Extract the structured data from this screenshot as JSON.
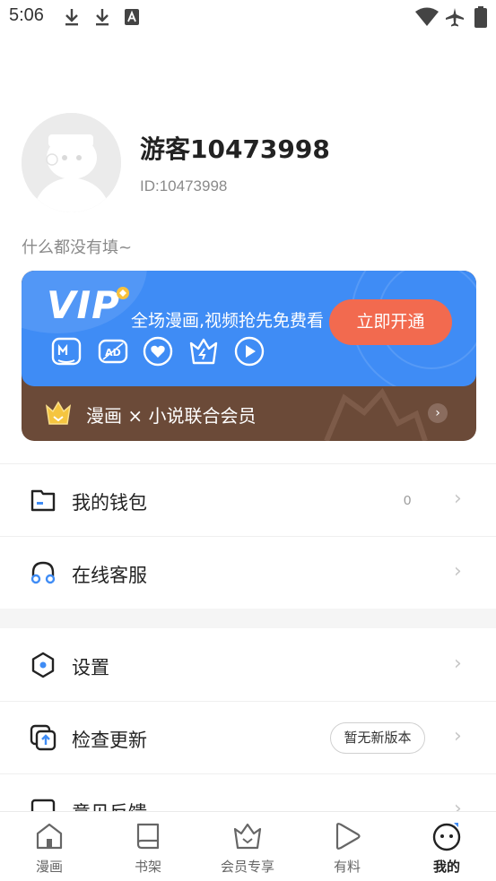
{
  "status_bar": {
    "time": "5:06",
    "icons": [
      "download-icon",
      "download-icon",
      "font-icon",
      "wifi-icon",
      "airplane-icon",
      "battery-icon"
    ]
  },
  "profile": {
    "username": "游客10473998",
    "user_id": "ID:10473998",
    "bio": "什么都没有填~"
  },
  "vip_card": {
    "logo": "VIP",
    "tagline": "全场漫画,视频抢先免费看",
    "open_button": "立即开通",
    "perk_icons": [
      "manga-icon",
      "no-ads-icon",
      "heart-icon",
      "crown-icon",
      "play-icon"
    ],
    "joint_membership": "漫画 × 小说联合会员",
    "colors": {
      "blue": "#3f8cf5",
      "brown": "#6b4a38",
      "button": "#f26a4f"
    }
  },
  "menu": {
    "wallet": {
      "label": "我的钱包",
      "value": "0"
    },
    "support": {
      "label": "在线客服"
    },
    "settings": {
      "label": "设置"
    },
    "update": {
      "label": "检查更新",
      "badge": "暂无新版本"
    },
    "feedback": {
      "label": "意见反馈"
    }
  },
  "bottom_nav": [
    {
      "label": "漫画",
      "icon": "home-icon"
    },
    {
      "label": "书架",
      "icon": "book-icon"
    },
    {
      "label": "会员专享",
      "icon": "crown-icon"
    },
    {
      "label": "有料",
      "icon": "play-icon"
    },
    {
      "label": "我的",
      "icon": "profile-face-icon",
      "active": true
    }
  ]
}
